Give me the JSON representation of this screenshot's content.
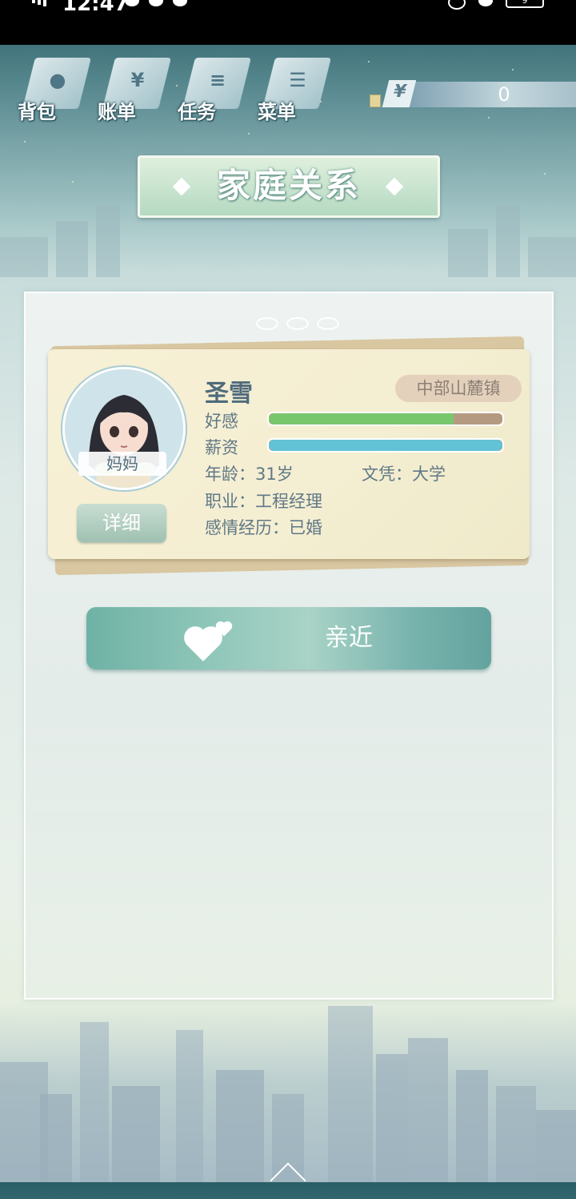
{
  "status_bar": {
    "time": "12:47",
    "battery": "9"
  },
  "nav": {
    "items": [
      {
        "label": "背包",
        "icon": "bag-icon"
      },
      {
        "label": "账单",
        "icon": "bill-icon"
      },
      {
        "label": "任务",
        "icon": "task-icon"
      },
      {
        "label": "菜单",
        "icon": "menu-icon"
      }
    ]
  },
  "money": {
    "symbol": "¥",
    "amount": "0"
  },
  "title": "家庭关系",
  "member": {
    "relation": "妈妈",
    "name": "圣雪",
    "location": "中部山麓镇",
    "favor_label": "好感",
    "favor_level": 0.79,
    "salary_label": "薪资",
    "salary_level": 1.0,
    "age": "年龄：31岁",
    "education": "文凭：大学",
    "job": "职业：工程经理",
    "relationship": "感情经历：已婚",
    "detail_button": "详细"
  },
  "action_button": "亲近",
  "colors": {
    "favor": "#79c76c",
    "favor_rest": "#b59a82",
    "salary": "#62c2d6",
    "title_text": "#ffffff"
  }
}
